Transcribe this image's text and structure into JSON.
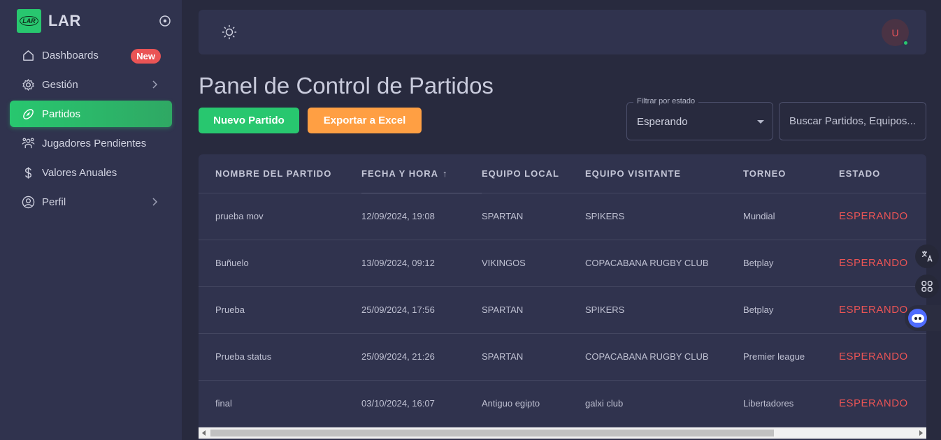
{
  "brand": {
    "name": "LAR",
    "logo_text": "LAR"
  },
  "sidebar": {
    "items": [
      {
        "label": "Dashboards",
        "icon": "home-icon",
        "badge": "New"
      },
      {
        "label": "Gestión",
        "icon": "gear-icon",
        "has_submenu": true
      },
      {
        "label": "Partidos",
        "icon": "football-icon",
        "active": true
      },
      {
        "label": "Jugadores Pendientes",
        "icon": "users-icon"
      },
      {
        "label": "Valores Anuales",
        "icon": "dollar-icon"
      },
      {
        "label": "Perfil",
        "icon": "user-circle-icon",
        "has_submenu": true
      }
    ]
  },
  "topbar": {
    "theme_icon": "sun-icon",
    "avatar_initial": "U",
    "status": "online"
  },
  "page": {
    "title": "Panel de Control de Partidos",
    "new_button": "Nuevo Partido",
    "export_button": "Exportar a Excel",
    "filter": {
      "label": "Filtrar por estado",
      "value": "Esperando"
    },
    "search": {
      "placeholder": "Buscar Partidos, Equipos..."
    }
  },
  "table": {
    "columns": [
      "NOMBRE DEL PARTIDO",
      "FECHA Y HORA",
      "EQUIPO LOCAL",
      "EQUIPO VISITANTE",
      "TORNEO",
      "ESTADO"
    ],
    "sort_column": "FECHA Y HORA",
    "sort_direction": "asc",
    "rows": [
      [
        "prueba mov",
        "12/09/2024, 19:08",
        "SPARTAN",
        "SPIKERS",
        "Mundial",
        "ESPERANDO"
      ],
      [
        "Buñuelo",
        "13/09/2024, 09:12",
        "VIKINGOS",
        "COPACABANA RUGBY CLUB",
        "Betplay",
        "ESPERANDO"
      ],
      [
        "Prueba",
        "25/09/2024, 17:56",
        "SPARTAN",
        "SPIKERS",
        "Betplay",
        "ESPERANDO"
      ],
      [
        "Prueba status",
        "25/09/2024, 21:26",
        "SPARTAN",
        "COPACABANA RUGBY CLUB",
        "Premier league",
        "ESPERANDO"
      ],
      [
        "final",
        "03/10/2024, 16:07",
        "Antiguo egipto",
        "galxi club",
        "Libertadores",
        "ESPERANDO"
      ]
    ]
  },
  "colors": {
    "accent_green": "#28c76f",
    "accent_orange": "#ff9f43",
    "status_red": "#ea5455",
    "background": "#282a3e",
    "panel": "#30334e"
  }
}
